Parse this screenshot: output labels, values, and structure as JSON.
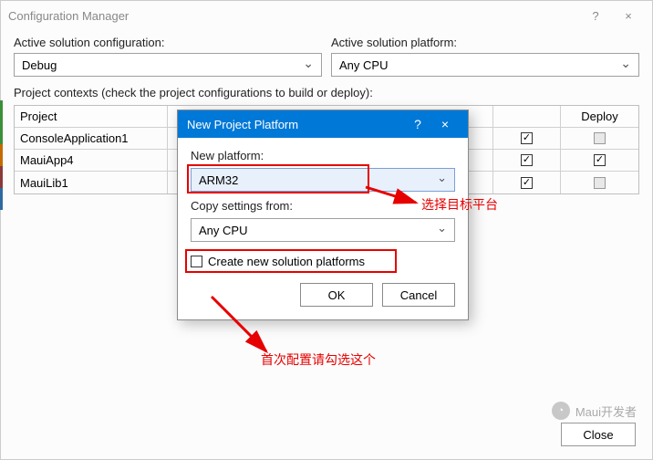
{
  "window": {
    "title": "Configuration Manager",
    "help": "?",
    "close": "×"
  },
  "labels": {
    "activeConfig": "Active solution configuration:",
    "activePlatform": "Active solution platform:",
    "contexts": "Project contexts (check the project configurations to build or deploy):"
  },
  "activeConfigValue": "Debug",
  "activePlatformValue": "Any CPU",
  "columns": {
    "project": "Project",
    "build": "",
    "deploy": "Deploy"
  },
  "rows": [
    {
      "name": "ConsoleApplication1",
      "build": true,
      "deploy": false,
      "deployDisabled": true
    },
    {
      "name": "MauiApp4",
      "build": true,
      "deploy": true,
      "deployDisabled": false
    },
    {
      "name": "MauiLib1",
      "build": true,
      "deploy": false,
      "deployDisabled": true
    }
  ],
  "closeBtn": "Close",
  "modal": {
    "title": "New Project Platform",
    "help": "?",
    "close": "×",
    "newPlatformLabel": "New platform:",
    "newPlatformValue": "ARM32",
    "copyFromLabel": "Copy settings from:",
    "copyFromValue": "Any CPU",
    "createNewLabel": "Create new solution platforms",
    "ok": "OK",
    "cancel": "Cancel"
  },
  "annotations": {
    "selectTarget": "选择目标平台",
    "firstConfig": "首次配置请勾选这个"
  },
  "watermark": "Maui开发者"
}
